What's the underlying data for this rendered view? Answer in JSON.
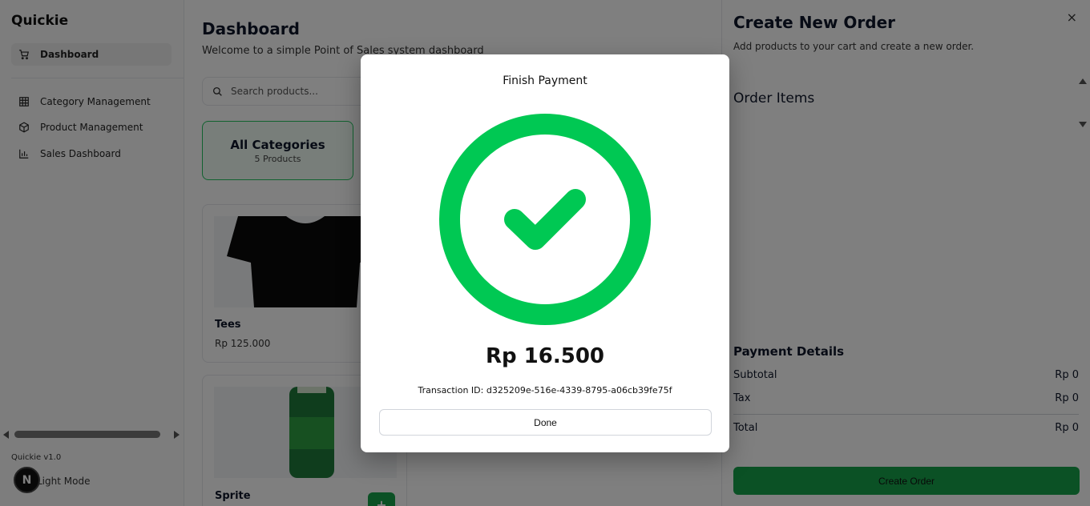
{
  "sidebar": {
    "brand": "Quickie",
    "items": [
      {
        "label": "Dashboard",
        "icon": "cart-icon",
        "active": true
      },
      {
        "label": "Category Management",
        "icon": "grid-icon"
      },
      {
        "label": "Product Management",
        "icon": "box-icon"
      },
      {
        "label": "Sales Dashboard",
        "icon": "bar-chart-icon"
      }
    ],
    "version": "Quickie v1.0",
    "theme_toggle": "Light Mode",
    "badge": "N"
  },
  "main": {
    "title": "Dashboard",
    "subtitle": "Welcome to a simple Point of Sales system dashboard",
    "search_placeholder": "Search products...",
    "category": {
      "title": "All Categories",
      "count": "5 Products"
    },
    "products": [
      {
        "name": "Tees",
        "price": "Rp 125.000"
      },
      {
        "name": "Sprite",
        "price": ""
      }
    ],
    "add_label": "+"
  },
  "panel": {
    "title": "Create New Order",
    "subtitle": "Add products to your cart and create a new order.",
    "close": "×",
    "order_items_title": "Order Items",
    "payment_details_title": "Payment Details",
    "subtotal_label": "Subtotal",
    "subtotal_value": "Rp 0",
    "tax_label": "Tax",
    "tax_value": "Rp 0",
    "total_label": "Total",
    "total_value": "Rp 0",
    "create_button": "Create Order"
  },
  "modal": {
    "title": "Finish Payment",
    "amount": "Rp 16.500",
    "transaction_label": "Transaction ID: d325209e-516e-4339-8795-a06cb39fe75f",
    "done_button": "Done"
  },
  "colors": {
    "accent": "#22c55e",
    "primary": "#16a34a",
    "overlay": "rgba(0,0,0,0.5)"
  }
}
